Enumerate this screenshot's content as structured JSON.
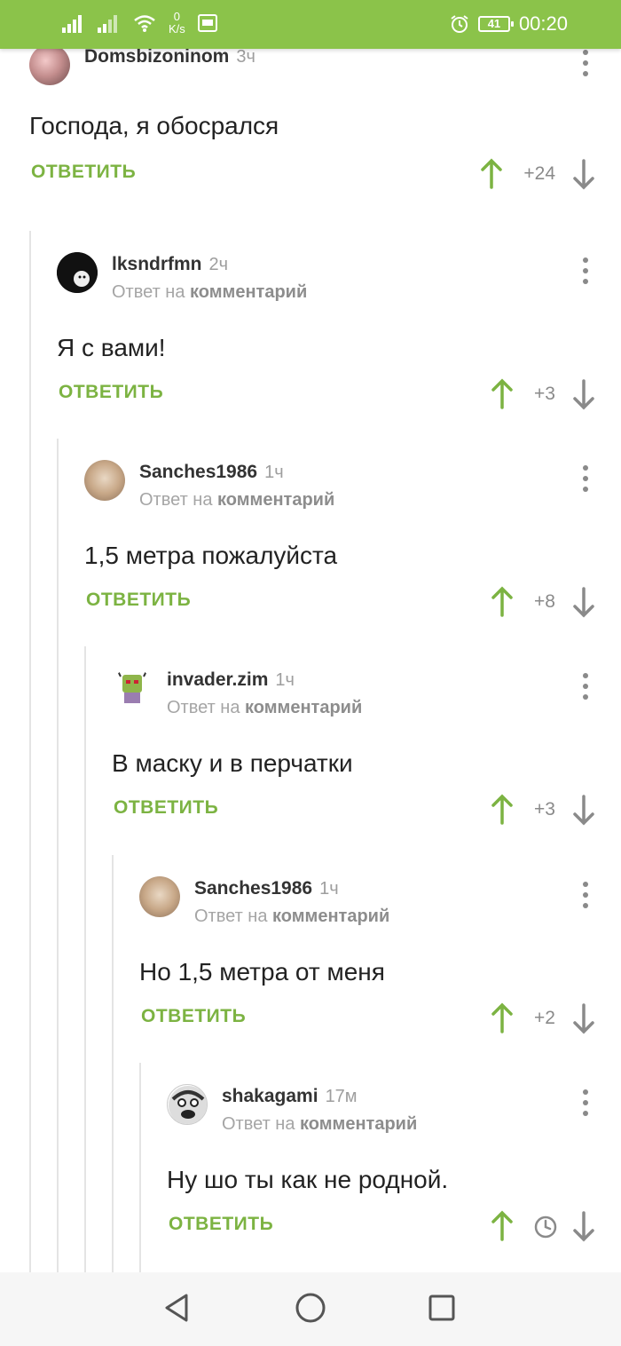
{
  "status_bar": {
    "net_speed_value": "0",
    "net_speed_unit": "K/s",
    "battery": "41",
    "time": "00:20"
  },
  "colors": {
    "accent": "#8bc34a",
    "reply_button": "#7cb342",
    "upvote": "#7cb342",
    "downvote": "#8a8a8a"
  },
  "reply_to_prefix": "Ответ на",
  "reply_to_link": "комментарий",
  "reply_label": "ОТВЕТИТЬ",
  "comments": [
    {
      "author": "Domsbizoninom",
      "time": "3ч",
      "text": "Господа, я обосрался",
      "score": "+24",
      "is_reply": false
    },
    {
      "author": "lksndrfmn",
      "time": "2ч",
      "text": "Я с вами!",
      "score": "+3",
      "is_reply": true
    },
    {
      "author": "Sanches1986",
      "time": "1ч",
      "text": "1,5 метра пожалуйста",
      "score": "+8",
      "is_reply": true
    },
    {
      "author": "invader.zim",
      "time": "1ч",
      "text": "В маску и в перчатки",
      "score": "+3",
      "is_reply": true
    },
    {
      "author": "Sanches1986",
      "time": "1ч",
      "text": "Но 1,5 метра от меня",
      "score": "+2",
      "is_reply": true
    },
    {
      "author": "shakagami",
      "time": "17м",
      "text": "Ну шо ты как не родной.",
      "score": "",
      "score_hidden_icon": "clock-icon",
      "is_reply": true
    }
  ],
  "nav_bar": {
    "back_icon": "triangle-back-icon",
    "home_icon": "circle-home-icon",
    "recents_icon": "square-recents-icon"
  }
}
